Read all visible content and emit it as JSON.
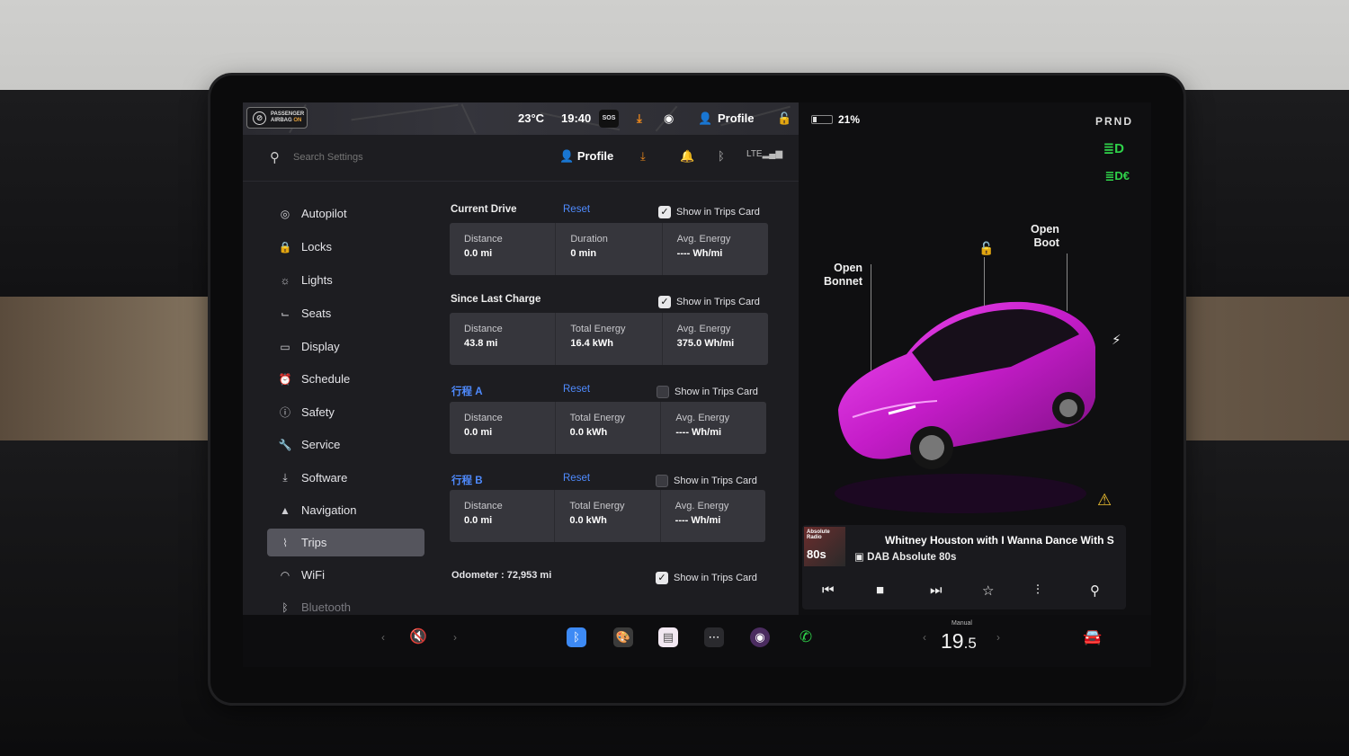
{
  "status_bar": {
    "airbag_line1": "PASSENGER",
    "airbag_line2": "AIRBAG",
    "airbag_state": "ON",
    "temperature": "23°C",
    "time": "19:40",
    "sos": "SOS",
    "profile_label": "Profile"
  },
  "search": {
    "placeholder": "Search Settings"
  },
  "header": {
    "profile_label": "Profile"
  },
  "nav": {
    "items": [
      {
        "label": "Autopilot",
        "icon": "steering-wheel-icon"
      },
      {
        "label": "Locks",
        "icon": "lock-icon"
      },
      {
        "label": "Lights",
        "icon": "light-icon"
      },
      {
        "label": "Seats",
        "icon": "seat-icon"
      },
      {
        "label": "Display",
        "icon": "display-icon"
      },
      {
        "label": "Schedule",
        "icon": "clock-icon"
      },
      {
        "label": "Safety",
        "icon": "info-icon"
      },
      {
        "label": "Service",
        "icon": "wrench-icon"
      },
      {
        "label": "Software",
        "icon": "download-icon"
      },
      {
        "label": "Navigation",
        "icon": "navigation-icon"
      },
      {
        "label": "Trips",
        "icon": "trips-icon"
      },
      {
        "label": "WiFi",
        "icon": "wifi-icon"
      },
      {
        "label": "Bluetooth",
        "icon": "bluetooth-icon"
      }
    ],
    "active": "Trips"
  },
  "trips": {
    "current_drive": {
      "title": "Current Drive",
      "reset": "Reset",
      "show_label": "Show in Trips Card",
      "checked": true,
      "stats": [
        {
          "label": "Distance",
          "value": "0.0  mi"
        },
        {
          "label": "Duration",
          "value": "0  min"
        },
        {
          "label": "Avg. Energy",
          "value": "----  Wh/mi"
        }
      ]
    },
    "since_last_charge": {
      "title": "Since Last Charge",
      "show_label": "Show in Trips Card",
      "checked": true,
      "stats": [
        {
          "label": "Distance",
          "value": "43.8  mi"
        },
        {
          "label": "Total Energy",
          "value": "16.4  kWh"
        },
        {
          "label": "Avg. Energy",
          "value": "375.0  Wh/mi"
        }
      ]
    },
    "trip_a": {
      "title": "行程 A",
      "reset": "Reset",
      "show_label": "Show in Trips Card",
      "checked": false,
      "stats": [
        {
          "label": "Distance",
          "value": "0.0  mi"
        },
        {
          "label": "Total Energy",
          "value": "0.0  kWh"
        },
        {
          "label": "Avg. Energy",
          "value": "----  Wh/mi"
        }
      ]
    },
    "trip_b": {
      "title": "行程 B",
      "reset": "Reset",
      "show_label": "Show in Trips Card",
      "checked": false,
      "stats": [
        {
          "label": "Distance",
          "value": "0.0  mi"
        },
        {
          "label": "Total Energy",
          "value": "0.0  kWh"
        },
        {
          "label": "Avg. Energy",
          "value": "----  Wh/mi"
        }
      ]
    },
    "odometer": "Odometer :  72,953  mi",
    "odometer_show_label": "Show in Trips Card",
    "odometer_checked": true
  },
  "vehicle": {
    "battery_percent": "21%",
    "gear": "PRND",
    "open_bonnet_1": "Open",
    "open_bonnet_2": "Bonnet",
    "open_boot_1": "Open",
    "open_boot_2": "Boot",
    "car_color": "#d21fd6"
  },
  "media": {
    "song": "Whitney Houston with I Wanna Dance With S",
    "station": "DAB Absolute 80s",
    "album_line1": "Absolute",
    "album_line2": "Radio",
    "album_big": "80s"
  },
  "dock": {
    "temperature_int": "19",
    "temperature_dec": ".5",
    "mode": "Manual"
  },
  "colors": {
    "accent": "#4f8bff",
    "green_indicator": "#2fd34a",
    "warning": "#f1c232"
  }
}
